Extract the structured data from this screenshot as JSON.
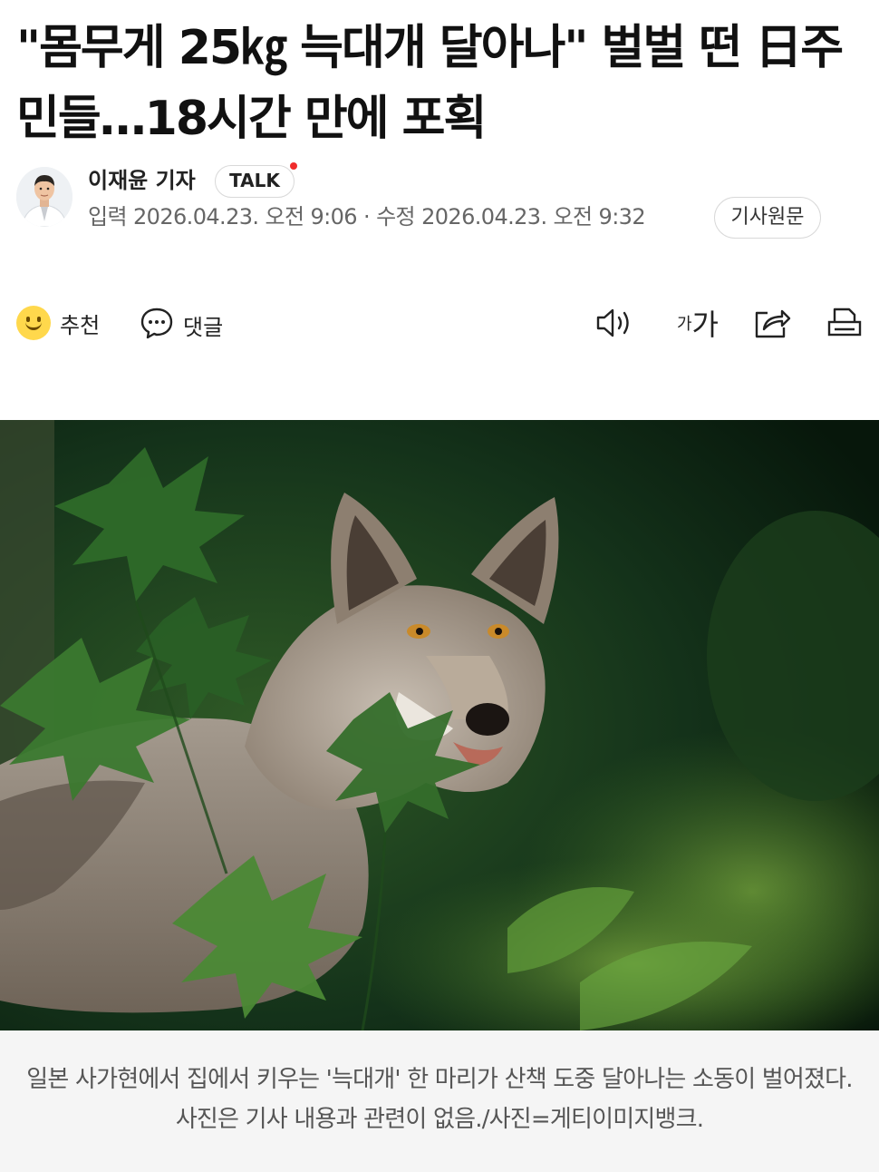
{
  "article": {
    "headline": "\"몸무게 25㎏ 늑대개 달아나\" 벌벌 떤 日주민들…18시간 만에 포획"
  },
  "byline": {
    "reporter": "이재윤 기자",
    "talk_label": "TALK",
    "input_label": "입력",
    "input_time": "2026.04.23. 오전 9:06",
    "separator": "·",
    "modified_label": "수정",
    "modified_time": "2026.04.23. 오전 9:32",
    "original_label": "기사원문"
  },
  "toolbar": {
    "recommend_label": "추천",
    "comment_label": "댓글",
    "icons": [
      "smile-icon",
      "comment-icon",
      "speaker-icon",
      "font-size-icon",
      "share-icon",
      "print-icon"
    ],
    "fontsize_small": "가",
    "fontsize_large": "가"
  },
  "photo": {
    "caption": "일본 사가현에서 집에서 키우는 '늑대개' 한 마리가 산책 도중 달아나는 소동이 벌어졌다. 사진은 기사 내용과 관련이 없음./사진=게티이미지뱅크."
  },
  "colors": {
    "accent_dot": "#f02c2c",
    "caption_bg": "#f5f5f5",
    "meta_text": "#666666"
  }
}
